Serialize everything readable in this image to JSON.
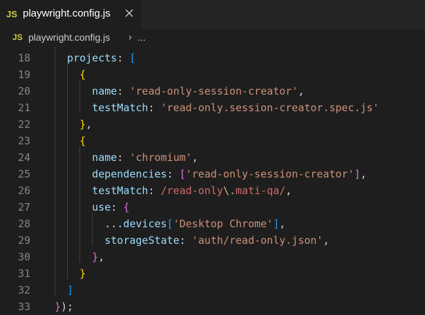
{
  "tab": {
    "badge": "JS",
    "label": "playwright.config.js",
    "close_glyph": "✕",
    "close_icon": "close-icon",
    "badge_color": "#cbcb41"
  },
  "breadcrumb": {
    "badge": "JS",
    "file": "playwright.config.js",
    "separator": "›",
    "more": "..."
  },
  "code_lines": [
    {
      "num": "18",
      "indent": "  ",
      "tokens": [
        [
          "p",
          "projects"
        ],
        [
          "d",
          ": "
        ],
        [
          "b3",
          "["
        ]
      ]
    },
    {
      "num": "19",
      "indent": "    ",
      "tokens": [
        [
          "b1",
          "{"
        ]
      ]
    },
    {
      "num": "20",
      "indent": "      ",
      "tokens": [
        [
          "p",
          "name"
        ],
        [
          "d",
          ": "
        ],
        [
          "s",
          "'read-only-session-creator'"
        ],
        [
          "d",
          ","
        ]
      ]
    },
    {
      "num": "21",
      "indent": "      ",
      "tokens": [
        [
          "p",
          "testMatch"
        ],
        [
          "d",
          ": "
        ],
        [
          "s",
          "'read-only.session-creator.spec.js'"
        ]
      ]
    },
    {
      "num": "22",
      "indent": "    ",
      "tokens": [
        [
          "b1",
          "}"
        ],
        [
          "d",
          ","
        ]
      ]
    },
    {
      "num": "23",
      "indent": "    ",
      "tokens": [
        [
          "b1",
          "{"
        ]
      ]
    },
    {
      "num": "24",
      "indent": "      ",
      "tokens": [
        [
          "p",
          "name"
        ],
        [
          "d",
          ": "
        ],
        [
          "s",
          "'chromium'"
        ],
        [
          "d",
          ","
        ]
      ]
    },
    {
      "num": "25",
      "indent": "      ",
      "tokens": [
        [
          "p",
          "dependencies"
        ],
        [
          "d",
          ": "
        ],
        [
          "b2",
          "["
        ],
        [
          "s",
          "'read-only-session-creator'"
        ],
        [
          "b2",
          "]"
        ],
        [
          "d",
          ","
        ]
      ]
    },
    {
      "num": "26",
      "indent": "      ",
      "tokens": [
        [
          "p",
          "testMatch"
        ],
        [
          "d",
          ": "
        ],
        [
          "r",
          "/read-only"
        ],
        [
          "re",
          "\\."
        ],
        [
          "r",
          "mati-qa/"
        ],
        [
          "d",
          ","
        ]
      ]
    },
    {
      "num": "27",
      "indent": "      ",
      "tokens": [
        [
          "p",
          "use"
        ],
        [
          "d",
          ": "
        ],
        [
          "b2",
          "{"
        ]
      ]
    },
    {
      "num": "28",
      "indent": "        ",
      "tokens": [
        [
          "d",
          "..."
        ],
        [
          "p",
          "devices"
        ],
        [
          "b3",
          "["
        ],
        [
          "s",
          "'Desktop Chrome'"
        ],
        [
          "b3",
          "]"
        ],
        [
          "d",
          ","
        ]
      ]
    },
    {
      "num": "29",
      "indent": "        ",
      "tokens": [
        [
          "p",
          "storageState"
        ],
        [
          "d",
          ": "
        ],
        [
          "s",
          "'auth/read-only.json'"
        ],
        [
          "d",
          ","
        ]
      ]
    },
    {
      "num": "30",
      "indent": "      ",
      "tokens": [
        [
          "b2",
          "}"
        ],
        [
          "d",
          ","
        ]
      ]
    },
    {
      "num": "31",
      "indent": "    ",
      "tokens": [
        [
          "b1",
          "}"
        ]
      ]
    },
    {
      "num": "32",
      "indent": "  ",
      "tokens": [
        [
          "b3",
          "]"
        ]
      ]
    },
    {
      "num": "33",
      "indent": "",
      "tokens": [
        [
          "b2",
          "}"
        ],
        [
          "d",
          ");"
        ]
      ]
    }
  ],
  "colors": {
    "editor_bg": "#1e1e1e",
    "property": "#9cdcfe",
    "string": "#ce9178",
    "bracket_gold": "#ffd700",
    "bracket_orchid": "#da70d6",
    "bracket_blue": "#179fff",
    "regex": "#d16969"
  }
}
